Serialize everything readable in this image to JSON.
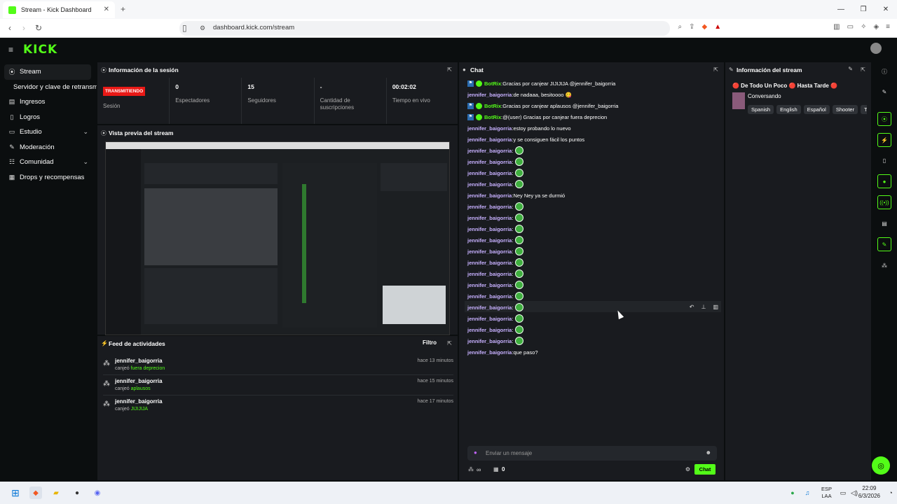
{
  "browser": {
    "tab_title": "Stream - Kick Dashboard",
    "tab_close": "✕",
    "new_tab": "+",
    "url": "dashboard.kick.com/stream",
    "min": "—",
    "max": "❐",
    "close": "✕"
  },
  "header": {
    "logo": "KICK",
    "menu": "≡"
  },
  "sidebar": {
    "items": [
      {
        "label": "Stream",
        "icon": "((•))"
      },
      {
        "label": "Servidor y clave de retransmisión"
      },
      {
        "label": "Ingresos",
        "icon": "▤"
      },
      {
        "label": "Logros",
        "icon": "▯"
      },
      {
        "label": "Estudio",
        "icon": "▭"
      },
      {
        "label": "Moderación",
        "icon": "✎"
      },
      {
        "label": "Comunidad",
        "icon": "☷"
      },
      {
        "label": "Drops y recompensas",
        "icon": "▦"
      }
    ]
  },
  "session": {
    "title": "Información de la sesión",
    "stats": [
      {
        "value": "TRANSMITIENDO",
        "label": "Sesión"
      },
      {
        "value": "0",
        "label": "Espectadores"
      },
      {
        "value": "15",
        "label": "Seguidores"
      },
      {
        "value": "-",
        "label": "Cantidad de suscripciones"
      },
      {
        "value": "00:02:02",
        "label": "Tiempo en vivo"
      }
    ]
  },
  "preview": {
    "title": "Vista previa del stream"
  },
  "feed": {
    "title": "Feed de actividades",
    "filter": "Filtro",
    "items": [
      {
        "user": "jennifer_baigorria",
        "action": "canjeó",
        "reward": "fuera deprecion",
        "time": "hace 13 minutos"
      },
      {
        "user": "jennifer_baigorria",
        "action": "canjeó",
        "reward": "aplausos",
        "time": "hace 15 minutos"
      },
      {
        "user": "jennifer_baigorria",
        "action": "canjeó",
        "reward": "JIJIJIJA",
        "time": "hace 17 minutos"
      }
    ]
  },
  "chat": {
    "title": "Chat",
    "messages": [
      {
        "user": "BotRix",
        "bot": true,
        "text": "Gracias por canjear JIJIJIJA @jennifer_baigorria"
      },
      {
        "user": "jennifer_baigorria",
        "text": "de nadaaa, besitoooo 😋"
      },
      {
        "user": "BotRix",
        "bot": true,
        "text": "Gracias por canjear aplausos @jennifer_baigorria"
      },
      {
        "user": "BotRix",
        "bot": true,
        "text": "@(user) Gracias por canjear fuera deprecion"
      },
      {
        "user": "jennifer_baigorria",
        "text": "estoy probando lo nuevo"
      },
      {
        "user": "jennifer_baigorria",
        "text": "y se consiguen fácil los puntos"
      },
      {
        "user": "jennifer_baigorria",
        "text": "",
        "emote": true
      },
      {
        "user": "jennifer_baigorria",
        "text": "",
        "emote": true
      },
      {
        "user": "jennifer_baigorria",
        "text": "",
        "emote": true
      },
      {
        "user": "jennifer_baigorria",
        "text": "",
        "emote": true
      },
      {
        "user": "jennifer_baigorria",
        "text": "Ney Ney ya se durmió"
      },
      {
        "user": "jennifer_baigorria",
        "text": "",
        "emote": true
      },
      {
        "user": "jennifer_baigorria",
        "text": "",
        "emote": true
      },
      {
        "user": "jennifer_baigorria",
        "text": "",
        "emote": true
      },
      {
        "user": "jennifer_baigorria",
        "text": "",
        "emote": true
      },
      {
        "user": "jennifer_baigorria",
        "text": "",
        "emote": true
      },
      {
        "user": "jennifer_baigorria",
        "text": "",
        "emote": true
      },
      {
        "user": "jennifer_baigorria",
        "text": "",
        "emote": true
      },
      {
        "user": "jennifer_baigorria",
        "text": "",
        "emote": true
      },
      {
        "user": "jennifer_baigorria",
        "text": "",
        "emote": true
      },
      {
        "user": "jennifer_baigorria",
        "text": "",
        "emote": true
      },
      {
        "user": "jennifer_baigorria",
        "text": "",
        "emote": true
      },
      {
        "user": "jennifer_baigorria",
        "text": "",
        "emote": true
      },
      {
        "user": "jennifer_baigorria",
        "text": "",
        "emote": true
      },
      {
        "user": "jennifer_baigorria",
        "text": "que paso?"
      }
    ],
    "placeholder": "Enviar un mensaje",
    "points": "∞",
    "count": "0",
    "send": "Chat"
  },
  "stream_info": {
    "title": "Información del stream",
    "stream_title": "🔴 De Todo Un Poco 🔴 Hasta Tarde 🔴",
    "category": "Conversando",
    "tags": [
      "Spanish",
      "English",
      "Español",
      "Shooter",
      "T"
    ]
  },
  "taskbar": {
    "lang1": "ESP",
    "lang2": "LAA",
    "time": "22:09",
    "date": "6/3/2026"
  }
}
